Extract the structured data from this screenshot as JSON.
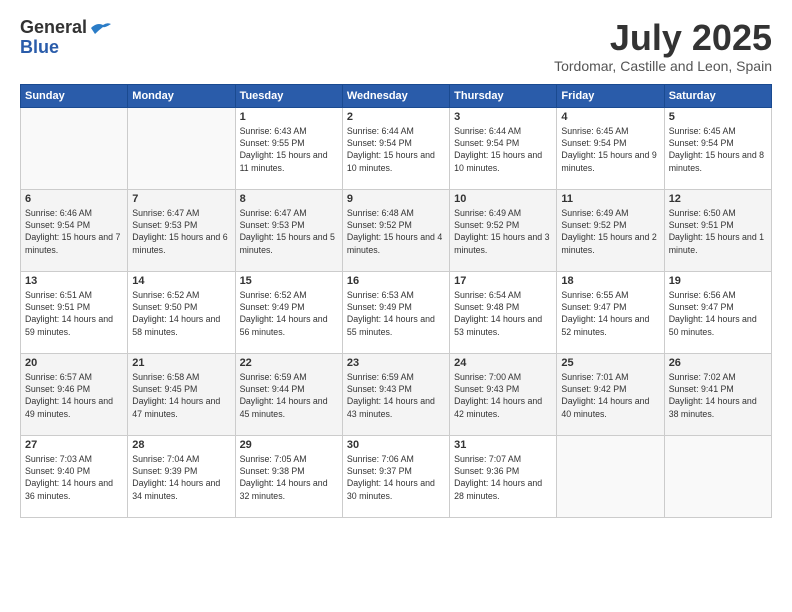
{
  "logo": {
    "general": "General",
    "blue": "Blue"
  },
  "title": "July 2025",
  "subtitle": "Tordomar, Castille and Leon, Spain",
  "days_header": [
    "Sunday",
    "Monday",
    "Tuesday",
    "Wednesday",
    "Thursday",
    "Friday",
    "Saturday"
  ],
  "weeks": [
    [
      {
        "day": "",
        "info": ""
      },
      {
        "day": "",
        "info": ""
      },
      {
        "day": "1",
        "info": "Sunrise: 6:43 AM\nSunset: 9:55 PM\nDaylight: 15 hours and 11 minutes."
      },
      {
        "day": "2",
        "info": "Sunrise: 6:44 AM\nSunset: 9:54 PM\nDaylight: 15 hours and 10 minutes."
      },
      {
        "day": "3",
        "info": "Sunrise: 6:44 AM\nSunset: 9:54 PM\nDaylight: 15 hours and 10 minutes."
      },
      {
        "day": "4",
        "info": "Sunrise: 6:45 AM\nSunset: 9:54 PM\nDaylight: 15 hours and 9 minutes."
      },
      {
        "day": "5",
        "info": "Sunrise: 6:45 AM\nSunset: 9:54 PM\nDaylight: 15 hours and 8 minutes."
      }
    ],
    [
      {
        "day": "6",
        "info": "Sunrise: 6:46 AM\nSunset: 9:54 PM\nDaylight: 15 hours and 7 minutes."
      },
      {
        "day": "7",
        "info": "Sunrise: 6:47 AM\nSunset: 9:53 PM\nDaylight: 15 hours and 6 minutes."
      },
      {
        "day": "8",
        "info": "Sunrise: 6:47 AM\nSunset: 9:53 PM\nDaylight: 15 hours and 5 minutes."
      },
      {
        "day": "9",
        "info": "Sunrise: 6:48 AM\nSunset: 9:52 PM\nDaylight: 15 hours and 4 minutes."
      },
      {
        "day": "10",
        "info": "Sunrise: 6:49 AM\nSunset: 9:52 PM\nDaylight: 15 hours and 3 minutes."
      },
      {
        "day": "11",
        "info": "Sunrise: 6:49 AM\nSunset: 9:52 PM\nDaylight: 15 hours and 2 minutes."
      },
      {
        "day": "12",
        "info": "Sunrise: 6:50 AM\nSunset: 9:51 PM\nDaylight: 15 hours and 1 minute."
      }
    ],
    [
      {
        "day": "13",
        "info": "Sunrise: 6:51 AM\nSunset: 9:51 PM\nDaylight: 14 hours and 59 minutes."
      },
      {
        "day": "14",
        "info": "Sunrise: 6:52 AM\nSunset: 9:50 PM\nDaylight: 14 hours and 58 minutes."
      },
      {
        "day": "15",
        "info": "Sunrise: 6:52 AM\nSunset: 9:49 PM\nDaylight: 14 hours and 56 minutes."
      },
      {
        "day": "16",
        "info": "Sunrise: 6:53 AM\nSunset: 9:49 PM\nDaylight: 14 hours and 55 minutes."
      },
      {
        "day": "17",
        "info": "Sunrise: 6:54 AM\nSunset: 9:48 PM\nDaylight: 14 hours and 53 minutes."
      },
      {
        "day": "18",
        "info": "Sunrise: 6:55 AM\nSunset: 9:47 PM\nDaylight: 14 hours and 52 minutes."
      },
      {
        "day": "19",
        "info": "Sunrise: 6:56 AM\nSunset: 9:47 PM\nDaylight: 14 hours and 50 minutes."
      }
    ],
    [
      {
        "day": "20",
        "info": "Sunrise: 6:57 AM\nSunset: 9:46 PM\nDaylight: 14 hours and 49 minutes."
      },
      {
        "day": "21",
        "info": "Sunrise: 6:58 AM\nSunset: 9:45 PM\nDaylight: 14 hours and 47 minutes."
      },
      {
        "day": "22",
        "info": "Sunrise: 6:59 AM\nSunset: 9:44 PM\nDaylight: 14 hours and 45 minutes."
      },
      {
        "day": "23",
        "info": "Sunrise: 6:59 AM\nSunset: 9:43 PM\nDaylight: 14 hours and 43 minutes."
      },
      {
        "day": "24",
        "info": "Sunrise: 7:00 AM\nSunset: 9:43 PM\nDaylight: 14 hours and 42 minutes."
      },
      {
        "day": "25",
        "info": "Sunrise: 7:01 AM\nSunset: 9:42 PM\nDaylight: 14 hours and 40 minutes."
      },
      {
        "day": "26",
        "info": "Sunrise: 7:02 AM\nSunset: 9:41 PM\nDaylight: 14 hours and 38 minutes."
      }
    ],
    [
      {
        "day": "27",
        "info": "Sunrise: 7:03 AM\nSunset: 9:40 PM\nDaylight: 14 hours and 36 minutes."
      },
      {
        "day": "28",
        "info": "Sunrise: 7:04 AM\nSunset: 9:39 PM\nDaylight: 14 hours and 34 minutes."
      },
      {
        "day": "29",
        "info": "Sunrise: 7:05 AM\nSunset: 9:38 PM\nDaylight: 14 hours and 32 minutes."
      },
      {
        "day": "30",
        "info": "Sunrise: 7:06 AM\nSunset: 9:37 PM\nDaylight: 14 hours and 30 minutes."
      },
      {
        "day": "31",
        "info": "Sunrise: 7:07 AM\nSunset: 9:36 PM\nDaylight: 14 hours and 28 minutes."
      },
      {
        "day": "",
        "info": ""
      },
      {
        "day": "",
        "info": ""
      }
    ]
  ]
}
